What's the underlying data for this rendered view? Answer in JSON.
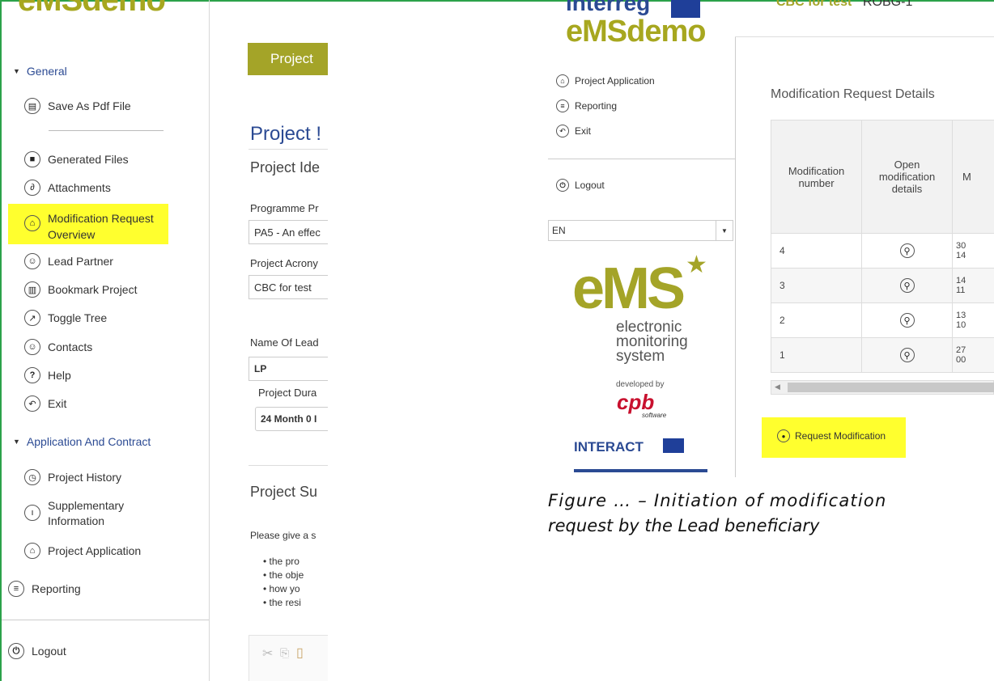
{
  "left_panel": {
    "brand": "eMSdemo",
    "sections": [
      {
        "label": "General"
      },
      {
        "label": "Application And Contract"
      }
    ],
    "items": [
      {
        "label": "Save As Pdf File",
        "icon": "print-icon"
      },
      {
        "label": "Generated Files",
        "icon": "save-icon"
      },
      {
        "label": "Attachments",
        "icon": "paperclip-icon"
      },
      {
        "label": "Modification Request Overview",
        "icon": "bank-icon"
      },
      {
        "label": "Lead Partner",
        "icon": "user-icon"
      },
      {
        "label": "Bookmark Project",
        "icon": "book-icon"
      },
      {
        "label": "Toggle Tree",
        "icon": "expand-icon"
      },
      {
        "label": "Contacts",
        "icon": "user-icon"
      },
      {
        "label": "Help",
        "icon": "help-icon"
      },
      {
        "label": "Exit",
        "icon": "exit-icon"
      },
      {
        "label": "Project History",
        "icon": "history-icon"
      },
      {
        "label": "Supplementary Information",
        "icon": "info-icon"
      },
      {
        "label": "Project Application",
        "icon": "bank-icon"
      },
      {
        "label": "Reporting",
        "icon": "report-icon"
      },
      {
        "label": "Logout",
        "icon": "power-icon"
      }
    ],
    "highlight_color": "#ffff2e"
  },
  "middle_panel": {
    "tab": "Project",
    "heading": "Project !",
    "subheading": "Project Ide",
    "programme_label": "Programme Pr",
    "programme_value": "PA5 - An effec",
    "acronym_label": "Project Acrony",
    "acronym_value": "CBC for test",
    "lead_label": "Name Of Lead",
    "lead_value": "LP",
    "duration_label": "Project Dura",
    "duration_value": "24 Month 0 I",
    "summary_heading": "Project Su",
    "summary_intro": "Please give a s",
    "bullets": [
      "the pro",
      "the obje",
      "how yo",
      "the resi"
    ],
    "tab_color": "#a4a428"
  },
  "right_panel": {
    "brand_top": "interreg",
    "brand": "eMSdemo",
    "header_text": "CBC for test",
    "header_code": "ROBG-1",
    "nav": [
      {
        "label": "Project Application",
        "icon": "bank-icon"
      },
      {
        "label": "Reporting",
        "icon": "report-icon"
      },
      {
        "label": "Exit",
        "icon": "exit-icon"
      },
      {
        "label": "Logout",
        "icon": "power-icon"
      }
    ],
    "language": "EN",
    "logo": {
      "big": "eMS",
      "line1": "electronic",
      "line2": "monitoring",
      "line3": "system",
      "developed_by": "developed by",
      "company": "cpb",
      "company_sub": "software",
      "interact": "INTERACT"
    },
    "section_title": "Modification Request Details",
    "table": {
      "headers": [
        "Modification number",
        "Open modification details",
        "M"
      ],
      "rows": [
        {
          "number": "4",
          "date1": "30",
          "date2": "14"
        },
        {
          "number": "3",
          "date1": "14",
          "date2": "11"
        },
        {
          "number": "2",
          "date1": "13",
          "date2": "10"
        },
        {
          "number": "1",
          "date1": "27",
          "date2": "00"
        }
      ]
    },
    "request_button": "Request Modification",
    "caption_line1": "Figure … – Initiation of modification",
    "caption_line2": "request by the Lead beneficiary"
  }
}
